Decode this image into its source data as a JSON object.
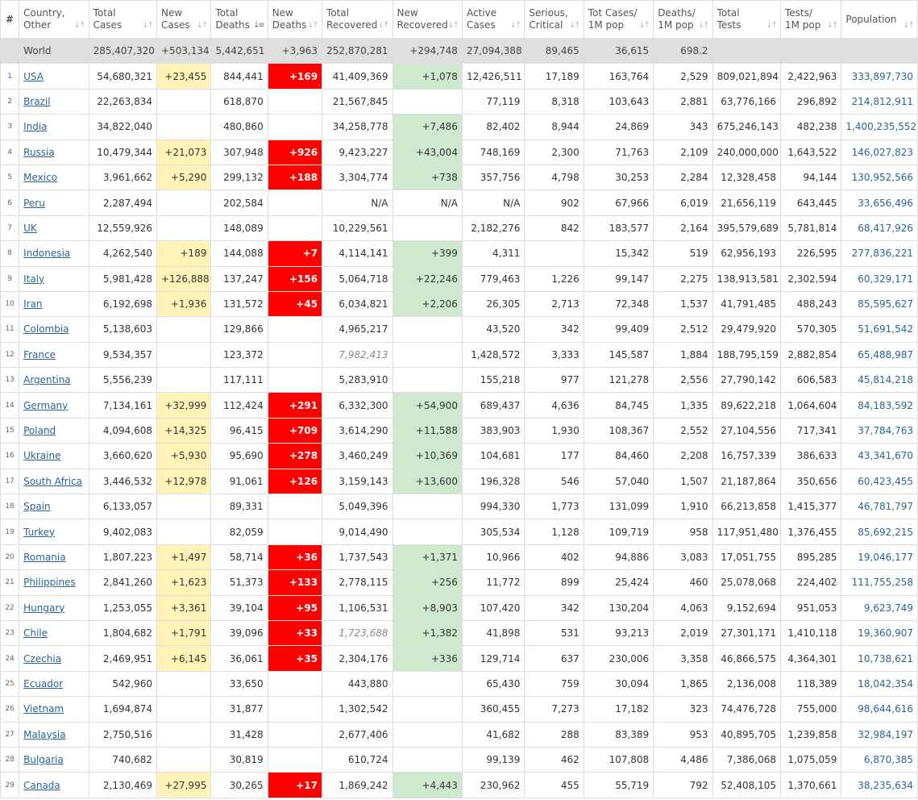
{
  "headers": {
    "num": "#",
    "country": [
      "Country,",
      "Other"
    ],
    "total_cases": [
      "Total",
      "Cases"
    ],
    "new_cases": [
      "New",
      "Cases"
    ],
    "total_deaths": [
      "Total",
      "Deaths"
    ],
    "new_deaths": [
      "New",
      "Deaths"
    ],
    "total_recovered": [
      "Total",
      "Recovered"
    ],
    "new_recovered": [
      "New",
      "Recovered"
    ],
    "active_cases": [
      "Active",
      "Cases"
    ],
    "serious": [
      "Serious,",
      "Critical"
    ],
    "tot_cases_1m": [
      "Tot Cases/",
      "1M pop"
    ],
    "deaths_1m": [
      "Deaths/",
      "1M pop"
    ],
    "total_tests": [
      "Total",
      "Tests"
    ],
    "tests_1m": [
      "Tests/",
      "1M pop"
    ],
    "population": [
      "Population"
    ]
  },
  "colors": {
    "new_cases_bg": "#fff3b8",
    "new_deaths_bg": "#ff0000",
    "new_recovered_bg": "#cfe9cf",
    "link": "#2a6496"
  },
  "world": {
    "country": "World",
    "total_cases": "285,407,320",
    "new_cases": "+503,134",
    "total_deaths": "5,442,651",
    "new_deaths": "+3,963",
    "total_recovered": "252,870,281",
    "new_recovered": "+294,748",
    "active_cases": "27,094,388",
    "serious": "89,465",
    "tot_cases_1m": "36,615",
    "deaths_1m": "698.2",
    "total_tests": "",
    "tests_1m": "",
    "population": ""
  },
  "rows": [
    {
      "n": "1",
      "country": "USA",
      "total_cases": "54,680,321",
      "new_cases": "+23,455",
      "total_deaths": "844,441",
      "new_deaths": "+169",
      "total_recovered": "41,409,369",
      "new_recovered": "+1,078",
      "active_cases": "12,426,511",
      "serious": "17,189",
      "tot_cases_1m": "163,764",
      "deaths_1m": "2,529",
      "total_tests": "809,021,894",
      "tests_1m": "2,422,963",
      "population": "333,897,730"
    },
    {
      "n": "2",
      "country": "Brazil",
      "total_cases": "22,263,834",
      "new_cases": "",
      "total_deaths": "618,870",
      "new_deaths": "",
      "total_recovered": "21,567,845",
      "new_recovered": "",
      "active_cases": "77,119",
      "serious": "8,318",
      "tot_cases_1m": "103,643",
      "deaths_1m": "2,881",
      "total_tests": "63,776,166",
      "tests_1m": "296,892",
      "population": "214,812,911"
    },
    {
      "n": "3",
      "country": "India",
      "total_cases": "34,822,040",
      "new_cases": "",
      "total_deaths": "480,860",
      "new_deaths": "",
      "total_recovered": "34,258,778",
      "new_recovered": "+7,486",
      "active_cases": "82,402",
      "serious": "8,944",
      "tot_cases_1m": "24,869",
      "deaths_1m": "343",
      "total_tests": "675,246,143",
      "tests_1m": "482,238",
      "population": "1,400,235,552"
    },
    {
      "n": "4",
      "country": "Russia",
      "total_cases": "10,479,344",
      "new_cases": "+21,073",
      "total_deaths": "307,948",
      "new_deaths": "+926",
      "total_recovered": "9,423,227",
      "new_recovered": "+43,004",
      "active_cases": "748,169",
      "serious": "2,300",
      "tot_cases_1m": "71,763",
      "deaths_1m": "2,109",
      "total_tests": "240,000,000",
      "tests_1m": "1,643,522",
      "population": "146,027,823"
    },
    {
      "n": "5",
      "country": "Mexico",
      "total_cases": "3,961,662",
      "new_cases": "+5,290",
      "total_deaths": "299,132",
      "new_deaths": "+188",
      "total_recovered": "3,304,774",
      "new_recovered": "+738",
      "active_cases": "357,756",
      "serious": "4,798",
      "tot_cases_1m": "30,253",
      "deaths_1m": "2,284",
      "total_tests": "12,328,458",
      "tests_1m": "94,144",
      "population": "130,952,566"
    },
    {
      "n": "6",
      "country": "Peru",
      "total_cases": "2,287,494",
      "new_cases": "",
      "total_deaths": "202,584",
      "new_deaths": "",
      "total_recovered": "N/A",
      "new_recovered": "N/A",
      "active_cases": "N/A",
      "serious": "902",
      "tot_cases_1m": "67,966",
      "deaths_1m": "6,019",
      "total_tests": "21,656,119",
      "tests_1m": "643,445",
      "population": "33,656,496"
    },
    {
      "n": "7",
      "country": "UK",
      "total_cases": "12,559,926",
      "new_cases": "",
      "total_deaths": "148,089",
      "new_deaths": "",
      "total_recovered": "10,229,561",
      "new_recovered": "",
      "active_cases": "2,182,276",
      "serious": "842",
      "tot_cases_1m": "183,577",
      "deaths_1m": "2,164",
      "total_tests": "395,579,689",
      "tests_1m": "5,781,814",
      "population": "68,417,926"
    },
    {
      "n": "8",
      "country": "Indonesia",
      "total_cases": "4,262,540",
      "new_cases": "+189",
      "total_deaths": "144,088",
      "new_deaths": "+7",
      "total_recovered": "4,114,141",
      "new_recovered": "+399",
      "active_cases": "4,311",
      "serious": "",
      "tot_cases_1m": "15,342",
      "deaths_1m": "519",
      "total_tests": "62,956,193",
      "tests_1m": "226,595",
      "population": "277,836,221"
    },
    {
      "n": "9",
      "country": "Italy",
      "total_cases": "5,981,428",
      "new_cases": "+126,888",
      "total_deaths": "137,247",
      "new_deaths": "+156",
      "total_recovered": "5,064,718",
      "new_recovered": "+22,246",
      "active_cases": "779,463",
      "serious": "1,226",
      "tot_cases_1m": "99,147",
      "deaths_1m": "2,275",
      "total_tests": "138,913,581",
      "tests_1m": "2,302,594",
      "population": "60,329,171"
    },
    {
      "n": "10",
      "country": "Iran",
      "total_cases": "6,192,698",
      "new_cases": "+1,936",
      "total_deaths": "131,572",
      "new_deaths": "+45",
      "total_recovered": "6,034,821",
      "new_recovered": "+2,206",
      "active_cases": "26,305",
      "serious": "2,713",
      "tot_cases_1m": "72,348",
      "deaths_1m": "1,537",
      "total_tests": "41,791,485",
      "tests_1m": "488,243",
      "population": "85,595,627"
    },
    {
      "n": "11",
      "country": "Colombia",
      "total_cases": "5,138,603",
      "new_cases": "",
      "total_deaths": "129,866",
      "new_deaths": "",
      "total_recovered": "4,965,217",
      "new_recovered": "",
      "active_cases": "43,520",
      "serious": "342",
      "tot_cases_1m": "99,409",
      "deaths_1m": "2,512",
      "total_tests": "29,479,920",
      "tests_1m": "570,305",
      "population": "51,691,542"
    },
    {
      "n": "12",
      "country": "France",
      "total_cases": "9,534,357",
      "new_cases": "",
      "total_deaths": "123,372",
      "new_deaths": "",
      "total_recovered": "7,982,413",
      "recovered_italic": true,
      "new_recovered": "",
      "active_cases": "1,428,572",
      "serious": "3,333",
      "tot_cases_1m": "145,587",
      "deaths_1m": "1,884",
      "total_tests": "188,795,159",
      "tests_1m": "2,882,854",
      "population": "65,488,987"
    },
    {
      "n": "13",
      "country": "Argentina",
      "total_cases": "5,556,239",
      "new_cases": "",
      "total_deaths": "117,111",
      "new_deaths": "",
      "total_recovered": "5,283,910",
      "new_recovered": "",
      "active_cases": "155,218",
      "serious": "977",
      "tot_cases_1m": "121,278",
      "deaths_1m": "2,556",
      "total_tests": "27,790,142",
      "tests_1m": "606,583",
      "population": "45,814,218"
    },
    {
      "n": "14",
      "country": "Germany",
      "total_cases": "7,134,161",
      "new_cases": "+32,999",
      "total_deaths": "112,424",
      "new_deaths": "+291",
      "total_recovered": "6,332,300",
      "new_recovered": "+54,900",
      "active_cases": "689,437",
      "serious": "4,636",
      "tot_cases_1m": "84,745",
      "deaths_1m": "1,335",
      "total_tests": "89,622,218",
      "tests_1m": "1,064,604",
      "population": "84,183,592"
    },
    {
      "n": "15",
      "country": "Poland",
      "total_cases": "4,094,608",
      "new_cases": "+14,325",
      "total_deaths": "96,415",
      "new_deaths": "+709",
      "total_recovered": "3,614,290",
      "new_recovered": "+11,588",
      "active_cases": "383,903",
      "serious": "1,930",
      "tot_cases_1m": "108,367",
      "deaths_1m": "2,552",
      "total_tests": "27,104,556",
      "tests_1m": "717,341",
      "population": "37,784,763"
    },
    {
      "n": "16",
      "country": "Ukraine",
      "total_cases": "3,660,620",
      "new_cases": "+5,930",
      "total_deaths": "95,690",
      "new_deaths": "+278",
      "total_recovered": "3,460,249",
      "new_recovered": "+10,369",
      "active_cases": "104,681",
      "serious": "177",
      "tot_cases_1m": "84,460",
      "deaths_1m": "2,208",
      "total_tests": "16,757,339",
      "tests_1m": "386,633",
      "population": "43,341,670"
    },
    {
      "n": "17",
      "country": "South Africa",
      "total_cases": "3,446,532",
      "new_cases": "+12,978",
      "total_deaths": "91,061",
      "new_deaths": "+126",
      "total_recovered": "3,159,143",
      "new_recovered": "+13,600",
      "active_cases": "196,328",
      "serious": "546",
      "tot_cases_1m": "57,040",
      "deaths_1m": "1,507",
      "total_tests": "21,187,864",
      "tests_1m": "350,656",
      "population": "60,423,455"
    },
    {
      "n": "18",
      "country": "Spain",
      "total_cases": "6,133,057",
      "new_cases": "",
      "total_deaths": "89,331",
      "new_deaths": "",
      "total_recovered": "5,049,396",
      "new_recovered": "",
      "active_cases": "994,330",
      "serious": "1,773",
      "tot_cases_1m": "131,099",
      "deaths_1m": "1,910",
      "total_tests": "66,213,858",
      "tests_1m": "1,415,377",
      "population": "46,781,797"
    },
    {
      "n": "19",
      "country": "Turkey",
      "total_cases": "9,402,083",
      "new_cases": "",
      "total_deaths": "82,059",
      "new_deaths": "",
      "total_recovered": "9,014,490",
      "new_recovered": "",
      "active_cases": "305,534",
      "serious": "1,128",
      "tot_cases_1m": "109,719",
      "deaths_1m": "958",
      "total_tests": "117,951,480",
      "tests_1m": "1,376,455",
      "population": "85,692,215"
    },
    {
      "n": "20",
      "country": "Romania",
      "total_cases": "1,807,223",
      "new_cases": "+1,497",
      "total_deaths": "58,714",
      "new_deaths": "+36",
      "total_recovered": "1,737,543",
      "new_recovered": "+1,371",
      "active_cases": "10,966",
      "serious": "402",
      "tot_cases_1m": "94,886",
      "deaths_1m": "3,083",
      "total_tests": "17,051,755",
      "tests_1m": "895,285",
      "population": "19,046,177"
    },
    {
      "n": "21",
      "country": "Philippines",
      "total_cases": "2,841,260",
      "new_cases": "+1,623",
      "total_deaths": "51,373",
      "new_deaths": "+133",
      "total_recovered": "2,778,115",
      "new_recovered": "+256",
      "active_cases": "11,772",
      "serious": "899",
      "tot_cases_1m": "25,424",
      "deaths_1m": "460",
      "total_tests": "25,078,068",
      "tests_1m": "224,402",
      "population": "111,755,258"
    },
    {
      "n": "22",
      "country": "Hungary",
      "total_cases": "1,253,055",
      "new_cases": "+3,361",
      "total_deaths": "39,104",
      "new_deaths": "+95",
      "total_recovered": "1,106,531",
      "new_recovered": "+8,903",
      "active_cases": "107,420",
      "serious": "342",
      "tot_cases_1m": "130,204",
      "deaths_1m": "4,063",
      "total_tests": "9,152,694",
      "tests_1m": "951,053",
      "population": "9,623,749"
    },
    {
      "n": "23",
      "country": "Chile",
      "total_cases": "1,804,682",
      "new_cases": "+1,791",
      "total_deaths": "39,096",
      "new_deaths": "+33",
      "total_recovered": "1,723,688",
      "recovered_italic": true,
      "new_recovered": "+1,382",
      "active_cases": "41,898",
      "serious": "531",
      "tot_cases_1m": "93,213",
      "deaths_1m": "2,019",
      "total_tests": "27,301,171",
      "tests_1m": "1,410,118",
      "population": "19,360,907"
    },
    {
      "n": "24",
      "country": "Czechia",
      "total_cases": "2,469,951",
      "new_cases": "+6,145",
      "total_deaths": "36,061",
      "new_deaths": "+35",
      "total_recovered": "2,304,176",
      "new_recovered": "+336",
      "active_cases": "129,714",
      "serious": "637",
      "tot_cases_1m": "230,006",
      "deaths_1m": "3,358",
      "total_tests": "46,866,575",
      "tests_1m": "4,364,301",
      "population": "10,738,621"
    },
    {
      "n": "25",
      "country": "Ecuador",
      "total_cases": "542,960",
      "new_cases": "",
      "total_deaths": "33,650",
      "new_deaths": "",
      "total_recovered": "443,880",
      "new_recovered": "",
      "active_cases": "65,430",
      "serious": "759",
      "tot_cases_1m": "30,094",
      "deaths_1m": "1,865",
      "total_tests": "2,136,008",
      "tests_1m": "118,389",
      "population": "18,042,354"
    },
    {
      "n": "26",
      "country": "Vietnam",
      "total_cases": "1,694,874",
      "new_cases": "",
      "total_deaths": "31,877",
      "new_deaths": "",
      "total_recovered": "1,302,542",
      "new_recovered": "",
      "active_cases": "360,455",
      "serious": "7,273",
      "tot_cases_1m": "17,182",
      "deaths_1m": "323",
      "total_tests": "74,476,728",
      "tests_1m": "755,000",
      "population": "98,644,616"
    },
    {
      "n": "27",
      "country": "Malaysia",
      "total_cases": "2,750,516",
      "new_cases": "",
      "total_deaths": "31,428",
      "new_deaths": "",
      "total_recovered": "2,677,406",
      "new_recovered": "",
      "active_cases": "41,682",
      "serious": "288",
      "tot_cases_1m": "83,389",
      "deaths_1m": "953",
      "total_tests": "40,895,705",
      "tests_1m": "1,239,858",
      "population": "32,984,197"
    },
    {
      "n": "28",
      "country": "Bulgaria",
      "total_cases": "740,682",
      "new_cases": "",
      "total_deaths": "30,819",
      "new_deaths": "",
      "total_recovered": "610,724",
      "new_recovered": "",
      "active_cases": "99,139",
      "serious": "462",
      "tot_cases_1m": "107,808",
      "deaths_1m": "4,486",
      "total_tests": "7,386,068",
      "tests_1m": "1,075,059",
      "population": "6,870,385"
    },
    {
      "n": "29",
      "country": "Canada",
      "total_cases": "2,130,469",
      "new_cases": "+27,995",
      "total_deaths": "30,265",
      "new_deaths": "+17",
      "total_recovered": "1,869,242",
      "new_recovered": "+4,443",
      "active_cases": "230,962",
      "serious": "455",
      "tot_cases_1m": "55,719",
      "deaths_1m": "792",
      "total_tests": "52,408,105",
      "tests_1m": "1,370,661",
      "population": "38,235,634"
    }
  ]
}
